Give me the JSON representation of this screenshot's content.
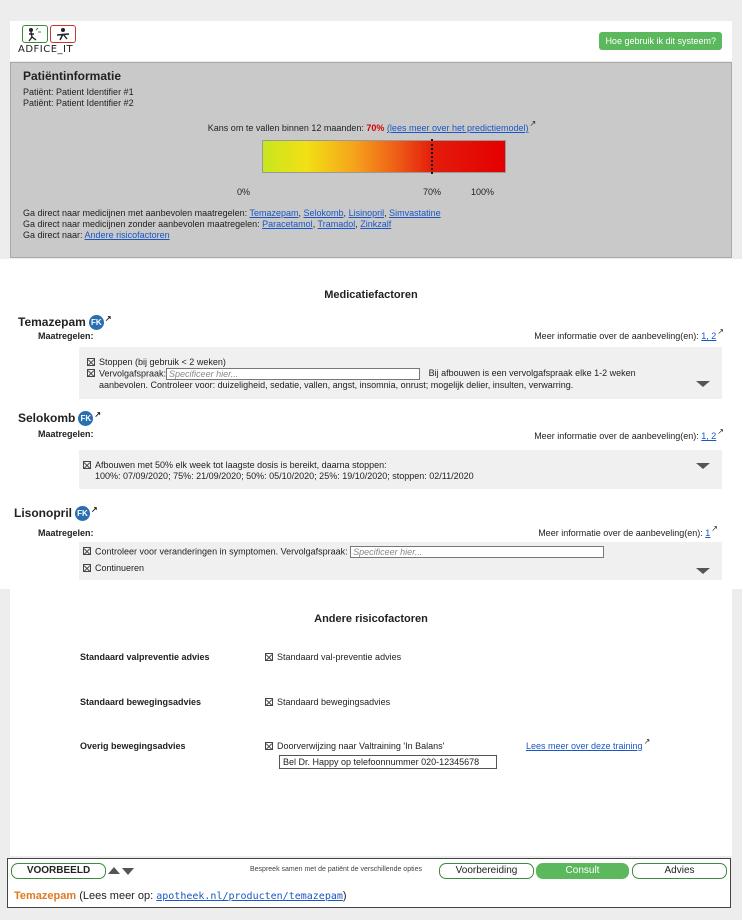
{
  "header": {
    "logo_text": "ADFICE_IT",
    "help_button": "Hoe gebruik ik dit systeem?"
  },
  "patient": {
    "title": "Patiëntinformatie",
    "line1": "Patiënt: Patient Identifier #1",
    "line2": "Patiënt: Patient Identifier #2",
    "risk_text": "Kans om te vallen binnen 12 maanden: ",
    "risk_value": "70%",
    "risk_link": "(lees meer over het predictiemodel)",
    "risk_fraction": 0.7,
    "bar_label_0": "0%",
    "bar_label_70": "70%",
    "bar_label_100": "100%",
    "nav1_text": "Ga direct naar medicijnen met aanbevolen maatregelen: ",
    "nav1_links": [
      "Temazepam",
      "Selokomb",
      "Lisinopril",
      "Simvastatine"
    ],
    "nav2_text": "Ga direct naar medicijnen zonder aanbevolen maatregelen: ",
    "nav2_links": [
      "Paracetamol",
      "Tramadol",
      "Zinkzalf"
    ],
    "nav3_text": "Ga direct naar: ",
    "nav3_link": "Andere risicofactoren"
  },
  "medication": {
    "section_title": "Medicatiefactoren",
    "maatregelen_label": "Maatregelen:",
    "fk_badge": "FK",
    "more_info_text": "Meer informatie over de aanbeveling(en): ",
    "placeholder": "Specificeer hier...",
    "temazepam": {
      "name": "Temazepam",
      "links": "1, 2",
      "opt1": "Stoppen (bij gebruik < 2 weken)",
      "opt2_label": "Vervolgafspraak:",
      "opt2_after": "Bij afbouwen is een vervolgafspraak elke 1-2 weken",
      "opt2_line2": "aanbevolen. Controleer voor: duizeligheid, sedatie, vallen, angst, insomnia, onrust; mogelijk delier, insulten, verwarring."
    },
    "selokomb": {
      "name": "Selokomb",
      "links": "1, 2",
      "opt1_line1": "Afbouwen met 50% elk week tot laagste dosis is bereikt, daarna stoppen:",
      "opt1_line2": "100%: 07/09/2020; 75%: 21/09/2020; 50%: 05/10/2020; 25%: 19/10/2020; stoppen: 02/11/2020"
    },
    "lisonopril": {
      "name": "Lisonopril",
      "links": "1",
      "opt1": "Controleer voor veranderingen in symptomen. Vervolgafspraak:",
      "opt2": "Continueren"
    }
  },
  "risk_factors": {
    "title": "Andere risicofactoren",
    "rows": [
      {
        "label": "Standaard valpreventie advies",
        "option": "Standaard val-preventie advies"
      },
      {
        "label": "Standaard bewegingsadvies",
        "option": "Standaard bewegingsadvies"
      },
      {
        "label": "Overig bewegingsadvies",
        "option": "Doorverwijzing naar Valtraining 'In Balans'",
        "link": "Lees meer over deze training",
        "input_value": "Bel Dr. Happy op telefoonnummer 020-12345678"
      }
    ]
  },
  "footer": {
    "example_button": "VOORBEELD",
    "discuss_text": "Bespreek samen met de patiënt de verschillende opties",
    "tabs": [
      "Voorbereiding",
      "Consult",
      "Advies"
    ],
    "active_tab": "Consult",
    "drug_name": "Temazepam",
    "info_prefix": " (Lees meer op: ",
    "info_link": "apotheek.nl/producten/temazepam",
    "info_suffix": ")"
  },
  "colors": {
    "accent_green": "#5cb85c",
    "risk_red": "#d40000",
    "link_blue": "#1a56c4",
    "drug_orange": "#e07a1f"
  }
}
